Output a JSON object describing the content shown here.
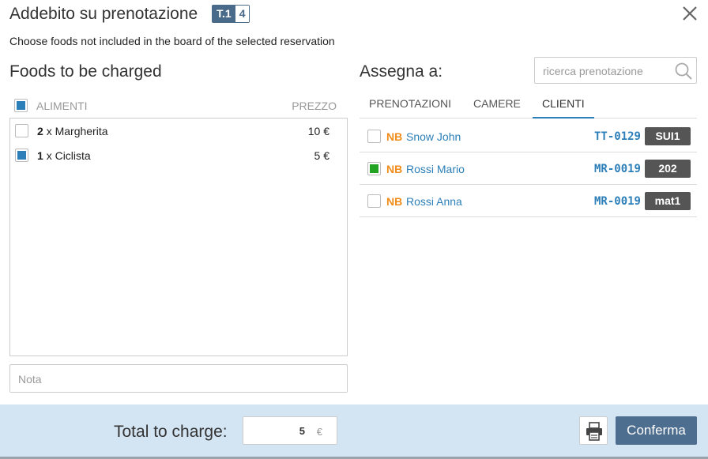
{
  "header": {
    "title": "Addebito su prenotazione",
    "table_badge_label": "T.1",
    "table_badge_count": "4"
  },
  "subtitle": "Choose foods not included in the board of the selected reservation",
  "foods": {
    "title": "Foods to be charged",
    "header_name": "ALIMENTI",
    "header_price": "PREZZO",
    "select_all_checked": true,
    "items": [
      {
        "qty": "2",
        "name": "x Margherita",
        "price": "10 €",
        "checked": false
      },
      {
        "qty": "1",
        "name": "x Ciclista",
        "price": "5 €",
        "checked": true
      }
    ],
    "note_placeholder": "Nota"
  },
  "assign": {
    "title": "Assegna a:",
    "search_placeholder": "ricerca prenotazione",
    "tabs": [
      {
        "label": "PRENOTAZIONI",
        "active": false
      },
      {
        "label": "CAMERE",
        "active": false
      },
      {
        "label": "CLIENTI",
        "active": true
      }
    ],
    "clients": [
      {
        "tag": "NB",
        "name": "Snow John",
        "code": "TT-0129",
        "room": "SUI1",
        "checked": false
      },
      {
        "tag": "NB",
        "name": "Rossi Mario",
        "code": "MR-0019",
        "room": "202",
        "checked": true
      },
      {
        "tag": "NB",
        "name": "Rossi Anna",
        "code": "MR-0019",
        "room": "mat1",
        "checked": false
      }
    ]
  },
  "footer": {
    "total_label": "Total to charge:",
    "total_value": "5",
    "currency": "€",
    "confirm_label": "Conferma"
  },
  "colors": {
    "accent": "#4d6e8f",
    "link": "#2c7fb8",
    "tag": "#f08c1a",
    "checked_green": "#22a322",
    "footer_bg": "#d3e5f3"
  }
}
